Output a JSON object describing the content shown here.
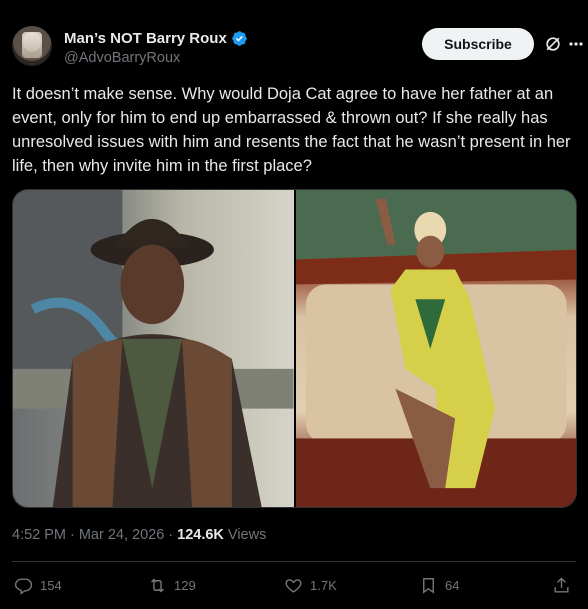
{
  "author": {
    "display_name": "Man’s NOT Barry Roux",
    "handle": "@AdvoBarryRoux"
  },
  "header": {
    "subscribe_label": "Subscribe"
  },
  "tweet": {
    "text": "It doesn’t make sense. Why would Doja Cat agree to have her father at an event, only for him to end up embarrassed & thrown out? If she really has unresolved issues with him and resents the fact that he wasn’t present in her life, then why invite him in the first place?"
  },
  "meta": {
    "time": "4:52 PM",
    "sep1": "·",
    "date": "Mar 24, 2026",
    "sep2": "·",
    "views_count": "124.6K",
    "views_label": "Views"
  },
  "actions": {
    "replies": "154",
    "retweets": "129",
    "likes": "1.7K",
    "bookmarks": "64"
  },
  "colors": {
    "background": "#000000",
    "text": "#e7e9ea",
    "secondary": "#71767b",
    "verified": "#1d9bf0",
    "divider": "#2f3336"
  },
  "icons": [
    "verified-badge-icon",
    "grok-icon",
    "more-icon",
    "reply-icon",
    "retweet-icon",
    "like-icon",
    "bookmark-icon",
    "share-icon"
  ]
}
